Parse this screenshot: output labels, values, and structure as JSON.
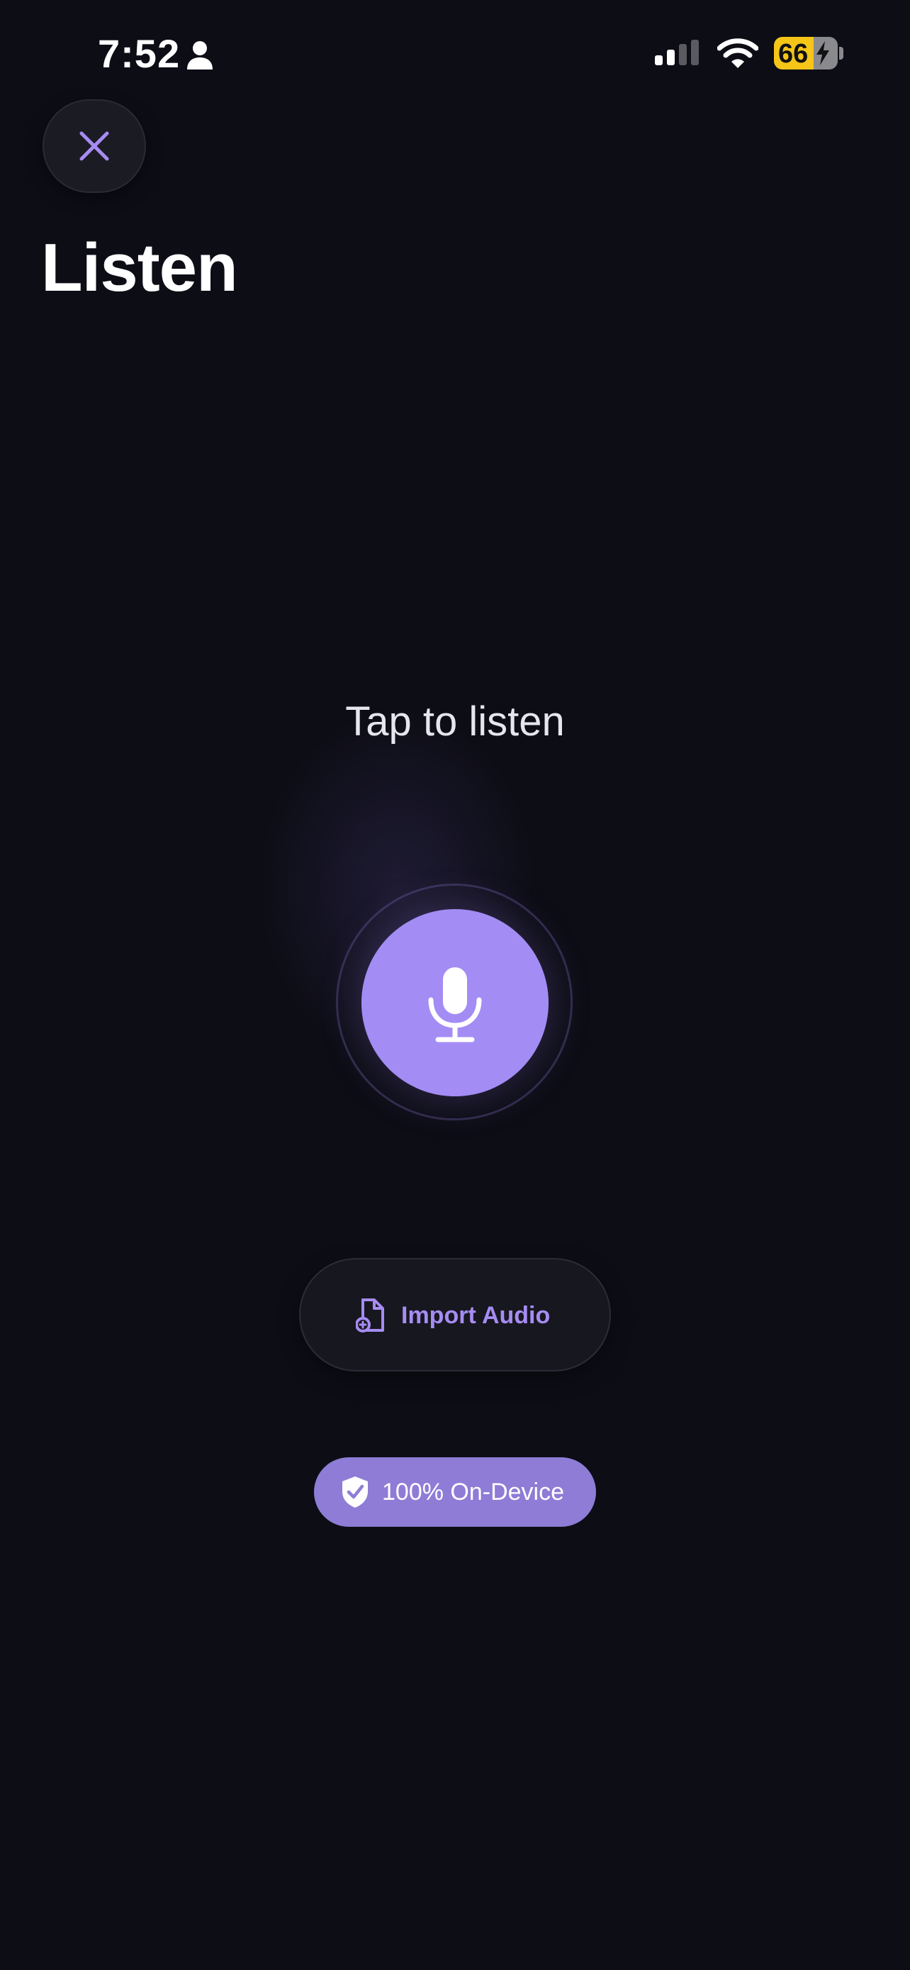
{
  "status_bar": {
    "time": "7:52",
    "battery_level": "66"
  },
  "header": {
    "close_icon": "close-icon",
    "title": "Listen"
  },
  "main": {
    "prompt": "Tap to listen",
    "mic_icon": "microphone-icon",
    "import_label": "Import Audio",
    "import_icon": "file-import-icon",
    "badge_label": "100% On-Device",
    "badge_icon": "shield-check-icon"
  },
  "colors": {
    "background": "#0d0d16",
    "accent": "#a48cf5",
    "accent_text": "#a68cf2",
    "badge": "#8e7cd6",
    "battery": "#f5c518"
  }
}
